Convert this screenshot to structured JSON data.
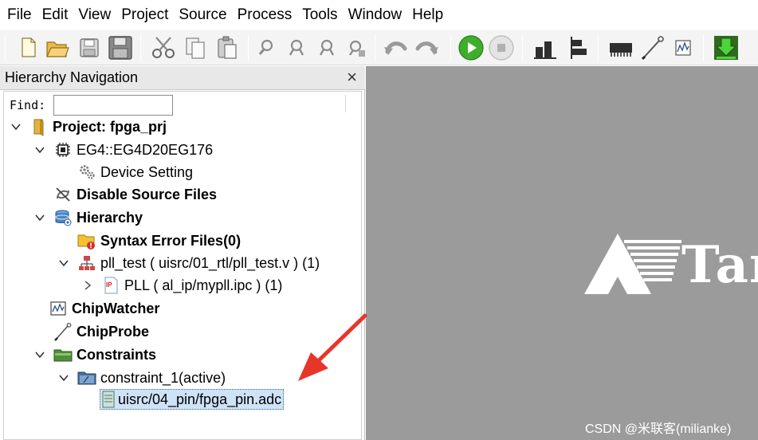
{
  "menu": [
    "File",
    "Edit",
    "View",
    "Project",
    "Source",
    "Process",
    "Tools",
    "Window",
    "Help"
  ],
  "toolbar": {
    "icons": [
      "new-file-icon",
      "open-folder-icon",
      "save-icon",
      "save-all-icon",
      "cut-icon",
      "copy-icon",
      "paste-icon",
      "find-icon",
      "find-prev-icon",
      "find-next-icon",
      "replace-icon",
      "undo-icon",
      "redo-icon",
      "run-icon",
      "stop-icon",
      "bar-chart-icon",
      "align-icon",
      "chip-icon",
      "probe-icon",
      "waveform-icon",
      "download-icon"
    ]
  },
  "panel": {
    "title": "Hierarchy Navigation",
    "close": "×",
    "find_label": "Find:",
    "find_value": ""
  },
  "tree": {
    "project": "Project: fpga_prj",
    "device": "EG4::EG4D20EG176",
    "device_setting": "Device Setting",
    "disable_source": "Disable Source Files",
    "hierarchy": "Hierarchy",
    "syntax_error": "Syntax Error Files(0)",
    "pll_test": "pll_test ( uisrc/01_rtl/pll_test.v )  (1)",
    "pll": "PLL ( al_ip/mypll.ipc ) (1)",
    "chipwatcher": "ChipWatcher",
    "chipprobe": "ChipProbe",
    "constraints": "Constraints",
    "constraint_1": "constraint_1(active)",
    "pin_file": "uisrc/04_pin/fpga_pin.adc",
    "ip_badge": "IP"
  },
  "workspace": {
    "logo_text": "Tan"
  },
  "watermark": "CSDN @米联客(milianke)",
  "colors": {
    "workspace_bg": "#9b9b9b",
    "selection_bg": "#cfe3f7",
    "arrow": "#e8352a",
    "run_green": "#3fae2a"
  }
}
